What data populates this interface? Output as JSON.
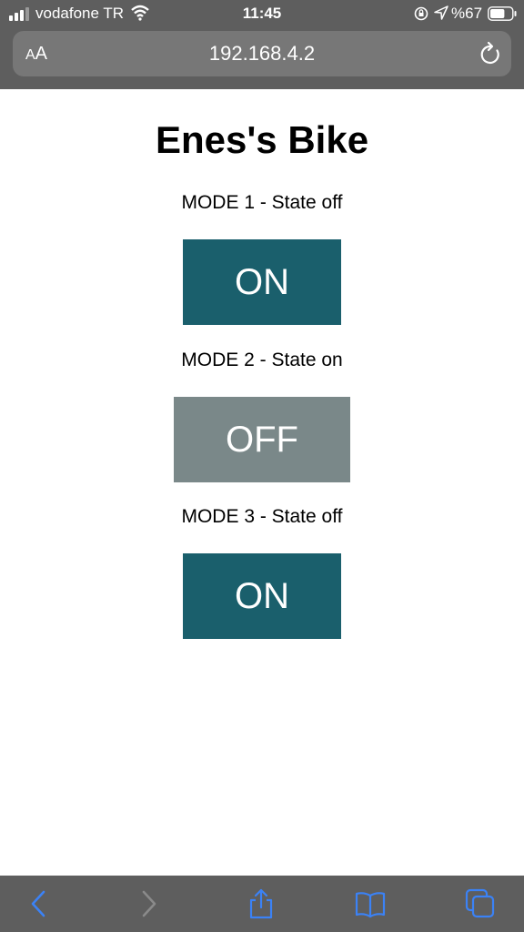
{
  "status_bar": {
    "carrier": "vodafone TR",
    "time": "11:45",
    "battery_percent": "%67",
    "battery_level": 0.67,
    "icons": [
      "signal-icon",
      "wifi-icon",
      "rotation-lock-icon",
      "location-arrow-icon",
      "battery-icon"
    ]
  },
  "browser": {
    "text_size_label_small": "A",
    "text_size_label_large": "A",
    "url": "192.168.4.2",
    "icons": [
      "reload-icon"
    ]
  },
  "page": {
    "title": "Enes's Bike",
    "modes": [
      {
        "label": "MODE 1 - State off",
        "button_label": "ON",
        "button_color": "#1a5f6c"
      },
      {
        "label": "MODE 2 - State on",
        "button_label": "OFF",
        "button_color": "#7a8889"
      },
      {
        "label": "MODE 3 - State off",
        "button_label": "ON",
        "button_color": "#1a5f6c"
      }
    ]
  },
  "toolbar": {
    "icons": [
      "back-icon",
      "forward-icon",
      "share-icon",
      "bookmarks-icon",
      "tabs-icon"
    ],
    "accent_color": "#3b82f6",
    "disabled_color": "#8a8a8a"
  },
  "colors": {
    "chrome_bg": "#5e5e5e",
    "urlbar_bg": "#777777"
  }
}
